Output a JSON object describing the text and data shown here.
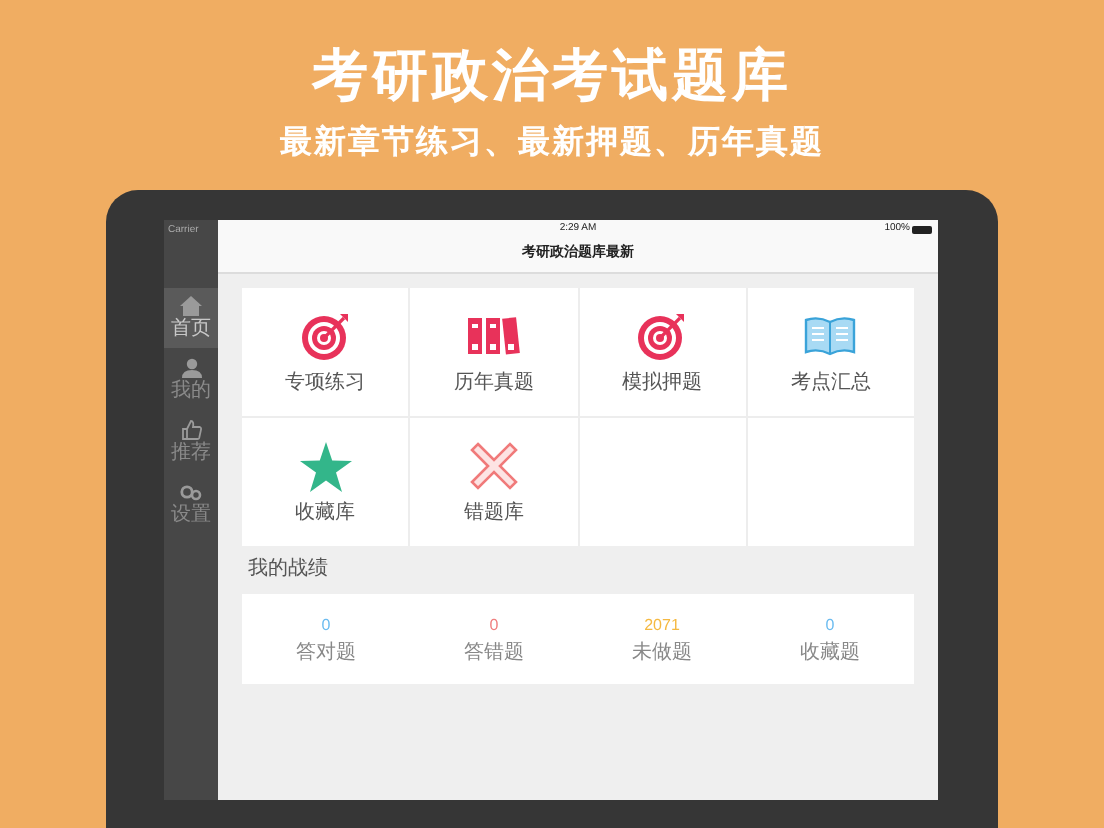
{
  "headline": "考研政治考试题库",
  "subheadline": "最新章节练习、最新押题、历年真题",
  "status_bar": {
    "carrier": "Carrier",
    "time": "2:29 AM",
    "battery": "100%"
  },
  "sidebar": {
    "items": [
      {
        "kind": "home",
        "label": "首页",
        "selected": true
      },
      {
        "kind": "person",
        "label": "我的",
        "selected": false
      },
      {
        "kind": "thumb",
        "label": "推荐",
        "selected": false
      },
      {
        "kind": "gears",
        "label": "设置",
        "selected": false
      }
    ]
  },
  "nav_title": "考研政治题库最新",
  "grid": [
    {
      "kind": "target",
      "label": "专项练习"
    },
    {
      "kind": "binders",
      "label": "历年真题"
    },
    {
      "kind": "target",
      "label": "模拟押题"
    },
    {
      "kind": "book",
      "label": "考点汇总"
    },
    {
      "kind": "star",
      "label": "收藏库"
    },
    {
      "kind": "cross",
      "label": "错题库"
    }
  ],
  "stats_title": "我的战绩",
  "stats": [
    {
      "value": "0",
      "label": "答对题",
      "color": "#6cbcf0"
    },
    {
      "value": "0",
      "label": "答错题",
      "color": "#f08080"
    },
    {
      "value": "2071",
      "label": "未做题",
      "color": "#f5b942"
    },
    {
      "value": "0",
      "label": "收藏题",
      "color": "#6cbcf0"
    }
  ]
}
